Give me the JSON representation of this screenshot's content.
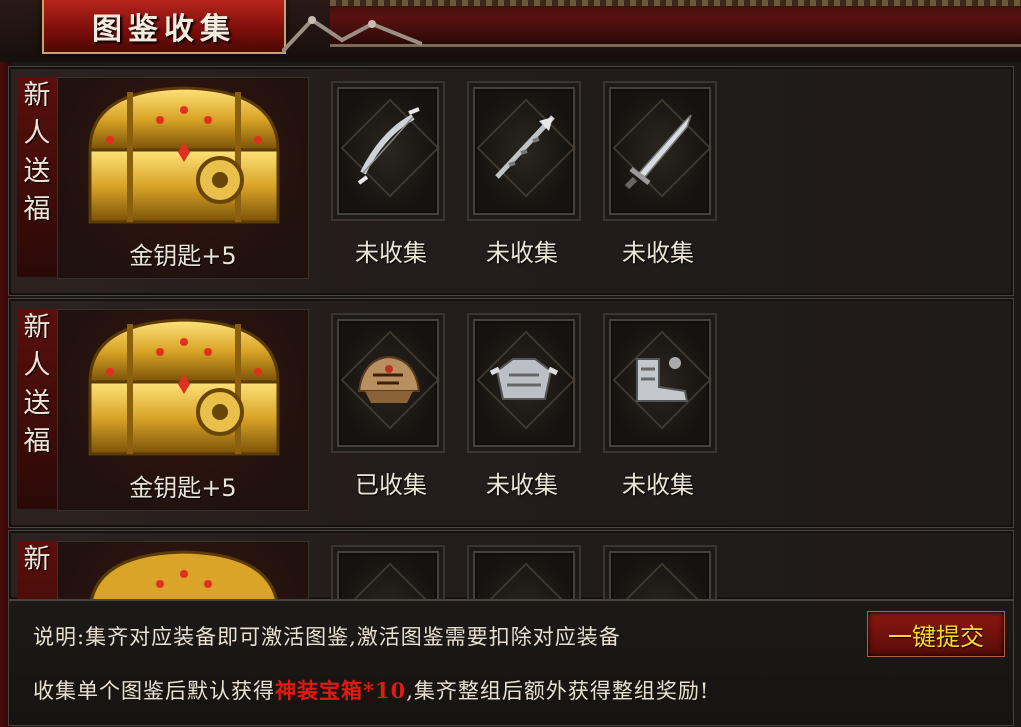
{
  "header": {
    "title": "图鉴收集"
  },
  "rows": [
    {
      "label": [
        "新",
        "人",
        "送",
        "福"
      ],
      "reward": "金钥匙+5",
      "items": [
        {
          "icon": "bow-icon",
          "status": "未收集"
        },
        {
          "icon": "spear-icon",
          "status": "未收集"
        },
        {
          "icon": "sword-icon",
          "status": "未收集"
        }
      ]
    },
    {
      "label": [
        "新",
        "人",
        "送",
        "福"
      ],
      "reward": "金钥匙+5",
      "items": [
        {
          "icon": "helmet-icon",
          "status": "已收集"
        },
        {
          "icon": "armor-icon",
          "status": "未收集"
        },
        {
          "icon": "boots-icon",
          "status": "未收集"
        }
      ]
    },
    {
      "label": [
        "新"
      ]
    }
  ],
  "footer": {
    "line1": "说明:集齐对应装备即可激活图鉴,激活图鉴需要扣除对应装备",
    "line2_before": "收集单个图鉴后默认获得",
    "line2_highlight": "神装宝箱*10",
    "line2_after": ",集齐整组后额外获得整组奖励!",
    "submit_label": "一键提交"
  },
  "colors": {
    "accent_red": "#e01a12",
    "button_text": "#ffd92e",
    "panel_bg": "#1b1816"
  }
}
